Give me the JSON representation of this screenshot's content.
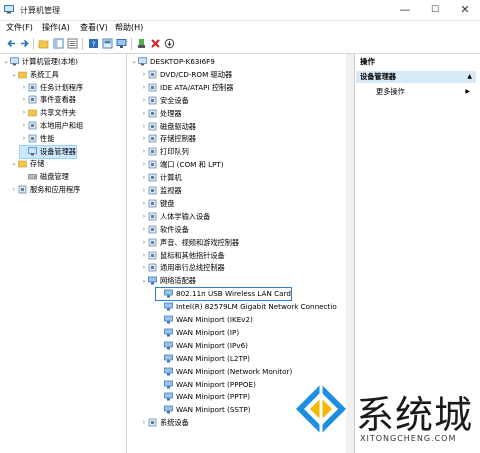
{
  "window": {
    "title": "计算机管理",
    "min": "—",
    "max": "☐",
    "close": "✕"
  },
  "menu": [
    "文件(F)",
    "操作(A)",
    "查看(V)",
    "帮助(H)"
  ],
  "left_tree": [
    {
      "label": "计算机管理(本地)",
      "expand": "⌄",
      "icon": "computer-management-icon"
    },
    {
      "label": "系统工具",
      "expand": "⌄",
      "icon": "tools-icon"
    },
    {
      "label": "任务计划程序",
      "expand": "›",
      "icon": "task-scheduler-icon"
    },
    {
      "label": "事件查看器",
      "expand": "›",
      "icon": "event-viewer-icon"
    },
    {
      "label": "共享文件夹",
      "expand": "›",
      "icon": "shared-folder-icon"
    },
    {
      "label": "本地用户和组",
      "expand": "›",
      "icon": "users-icon"
    },
    {
      "label": "性能",
      "expand": "›",
      "icon": "performance-icon"
    },
    {
      "label": "设备管理器",
      "expand": "",
      "icon": "device-manager-icon",
      "selected": true
    },
    {
      "label": "存储",
      "expand": "⌄",
      "icon": "storage-icon"
    },
    {
      "label": "磁盘管理",
      "expand": "",
      "icon": "disk-icon"
    },
    {
      "label": "服务和应用程序",
      "expand": "›",
      "icon": "services-icon"
    }
  ],
  "device_tree": {
    "root": "DESKTOP-K63I6F9",
    "categories": [
      "DVD/CD-ROM 驱动器",
      "IDE ATA/ATAPI 控制器",
      "安全设备",
      "处理器",
      "磁盘驱动器",
      "存储控制器",
      "打印队列",
      "端口 (COM 和 LPT)",
      "计算机",
      "监视器",
      "键盘",
      "人体学输入设备",
      "软件设备",
      "声音、视频和游戏控制器",
      "鼠标和其他指针设备",
      "通用串行总线控制器"
    ],
    "network": {
      "label": "网络适配器",
      "children": [
        "802.11n USB Wireless LAN Card",
        "Intel(R) 82579LM Gigabit Network Connectio",
        "WAN Miniport (IKEv2)",
        "WAN Miniport (IP)",
        "WAN Miniport (IPv6)",
        "WAN Miniport (L2TP)",
        "WAN Miniport (Network Monitor)",
        "WAN Miniport (PPPOE)",
        "WAN Miniport (PPTP)",
        "WAN Miniport (SSTP)"
      ]
    },
    "last": "系统设备"
  },
  "actions": {
    "header": "操作",
    "section": "设备管理器",
    "more": "更多操作",
    "arrow_up": "▲",
    "arrow_right": "▶"
  },
  "watermark": {
    "text": "系统城",
    "url": "XITONGCHENG.COM"
  },
  "colors": {
    "selection": "#cce8ff",
    "highlight_box": "#2f7fd0",
    "watermark_blue": "#1c8fe0"
  }
}
